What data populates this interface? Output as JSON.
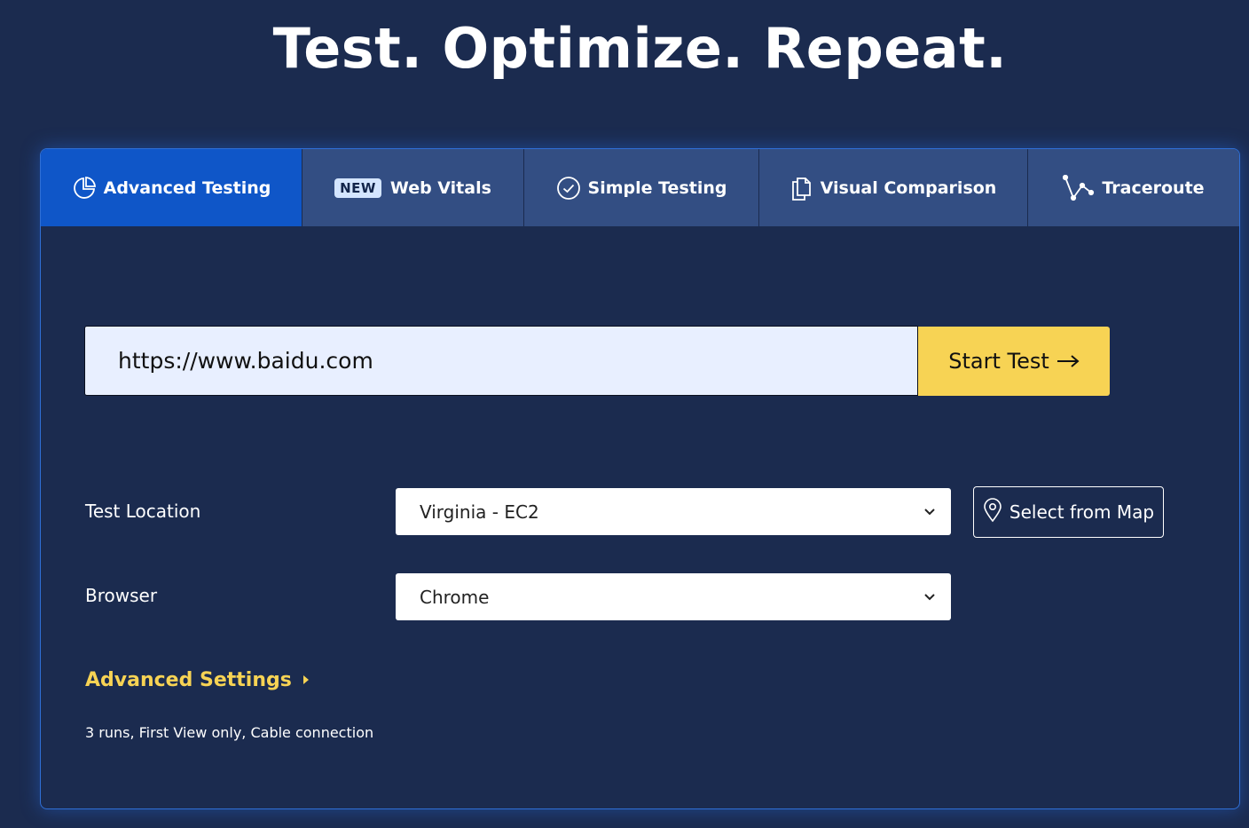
{
  "hero": {
    "title": "Test. Optimize. Repeat."
  },
  "tabs": [
    {
      "label": "Advanced Testing",
      "icon": "pie-chart-icon",
      "active": true
    },
    {
      "label": "Web Vitals",
      "badge": "NEW",
      "active": false
    },
    {
      "label": "Simple Testing",
      "icon": "check-circle-icon",
      "active": false
    },
    {
      "label": "Visual Comparison",
      "icon": "copy-documents-icon",
      "active": false
    },
    {
      "label": "Traceroute",
      "icon": "route-icon",
      "active": false
    }
  ],
  "url_field": {
    "value": "https://www.baidu.com"
  },
  "start_test": {
    "label": "Start Test",
    "icon": "arrow-right-icon"
  },
  "test_location": {
    "label": "Test Location",
    "selected": "Virginia - EC2",
    "icon": "chevron-down-icon"
  },
  "map_button": {
    "label": "Select from Map",
    "icon": "map-pin-icon"
  },
  "browser": {
    "label": "Browser",
    "selected": "Chrome",
    "icon": "chevron-down-icon"
  },
  "advanced_settings": {
    "label": "Advanced Settings",
    "icon": "caret-right-icon",
    "summary": "3 runs, First View only, Cable connection"
  },
  "colors": {
    "background": "#1b2b4f",
    "tab_inactive": "#334e83",
    "tab_active": "#0f56c8",
    "accent_yellow": "#f7d354",
    "panel_border": "#2f6fd6",
    "input_bg": "#e8efff"
  }
}
